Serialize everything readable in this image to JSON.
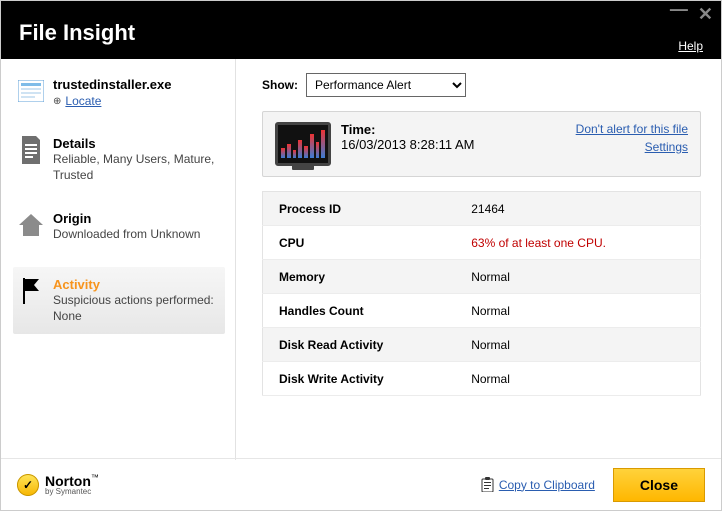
{
  "window": {
    "title": "File Insight",
    "help": "Help"
  },
  "file": {
    "name": "trustedinstaller.exe",
    "locate": "Locate"
  },
  "sidebar": {
    "details": {
      "title": "Details",
      "sub": "Reliable,  Many Users, Mature,  Trusted"
    },
    "origin": {
      "title": "Origin",
      "sub": "Downloaded from Unknown"
    },
    "activity": {
      "title": "Activity",
      "sub": "Suspicious actions performed: None"
    }
  },
  "show": {
    "label": "Show:",
    "selected": "Performance Alert"
  },
  "alert": {
    "time_label": "Time:",
    "time_value": "16/03/2013 8:28:11 AM",
    "dont_alert": "Don't alert for this file",
    "settings": "Settings"
  },
  "metrics": [
    {
      "key": "Process ID",
      "val": "21464",
      "warn": false
    },
    {
      "key": "CPU",
      "val": "63% of at least one CPU.",
      "warn": true
    },
    {
      "key": "Memory",
      "val": "Normal",
      "warn": false
    },
    {
      "key": "Handles Count",
      "val": "Normal",
      "warn": false
    },
    {
      "key": "Disk Read Activity",
      "val": "Normal",
      "warn": false
    },
    {
      "key": "Disk Write Activity",
      "val": "Normal",
      "warn": false
    }
  ],
  "footer": {
    "brand": "Norton",
    "brand_sub": "by Symantec",
    "copy": "Copy to Clipboard",
    "close": "Close"
  }
}
